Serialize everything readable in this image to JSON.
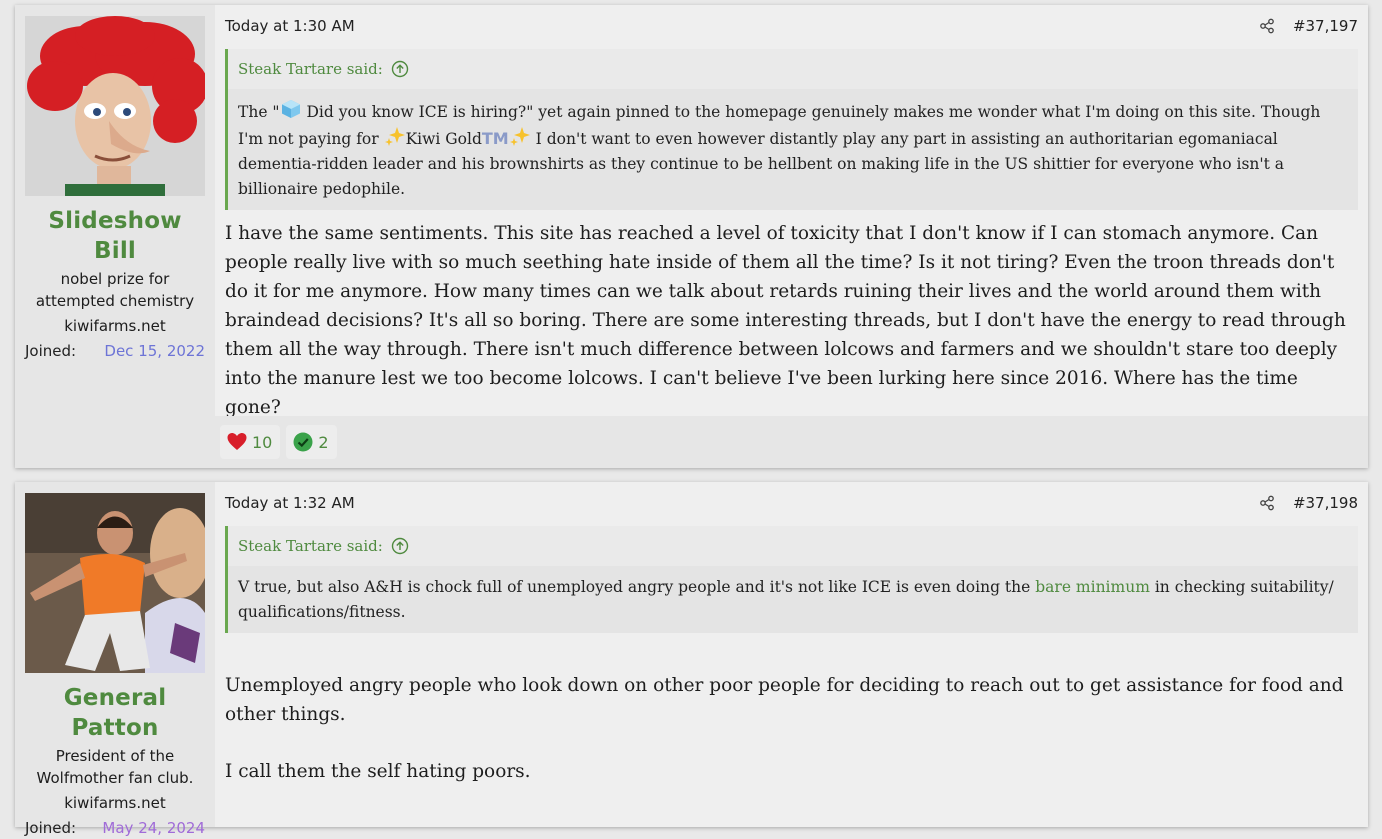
{
  "posts": [
    {
      "user": {
        "name": "Slideshow Bill",
        "title": "nobel prize for attempted chemistry",
        "banner": "kiwifarms.net",
        "joined_label": "Joined:",
        "joined_date": "Dec 15, 2022"
      },
      "time": "Today at 1:30 AM",
      "number": "#37,197",
      "quote": {
        "author": "Steak Tartare said:",
        "text_1": "The \"",
        "text_2": " Did you know ICE is hiring?\" yet again pinned to the homepage genuinely makes me wonder what I'm doing on this site. Though I'm not paying for ",
        "gold_label": "Kiwi Gold",
        "tm": "TM",
        "text_3": " I don't want to even however distantly play any part in assisting an authoritarian egomaniacal dementia-ridden leader and his brownshirts as they continue to be hellbent on making life in the US shittier for everyone who isn't a billionaire pedophile."
      },
      "message": "I have the same sentiments. This site has reached a level of toxicity that I don't know if I can stomach anymore. Can people really live with so much seething hate inside of them all the time? Is it not tiring? Even the troon threads don't do it for me anymore. How many times can we talk about retards ruining their lives and the world around them with braindead decisions? It's all so boring. There are some interesting threads, but I don't have the energy to read through them all the way through. There isn't much difference between lolcows and farmers and we shouldn't stare too deeply into the manure lest we too become lolcows. I can't believe I've been lurking here since 2016. Where has the time gone?",
      "reactions": [
        {
          "icon": "heart-icon",
          "count": "10"
        },
        {
          "icon": "check-icon",
          "count": "2"
        }
      ]
    },
    {
      "user": {
        "name": "General Patton",
        "title": "President of the Wolfmother fan club.",
        "banner": "kiwifarms.net",
        "joined_label": "Joined:",
        "joined_date": "May 24, 2024"
      },
      "time": "Today at 1:32 AM",
      "number": "#37,198",
      "quote": {
        "author": "Steak Tartare said:",
        "text_1": "V true, but also A&H is chock full of unemployed angry people and it's not like ICE is even doing the ",
        "link": "bare minimum",
        "text_2": " in checking suitability/ qualifications/fitness."
      },
      "message_p1": "Unemployed angry people who look down on other poor people for deciding to reach out to get assistance for food and other things.",
      "message_p2": "I call them the self hating poors."
    }
  ],
  "colors": {
    "username": "#4f8a3f",
    "joined_blue": "#6d74d6",
    "joined_purple": "#a06bd8",
    "quote_border": "#6aa84f"
  }
}
